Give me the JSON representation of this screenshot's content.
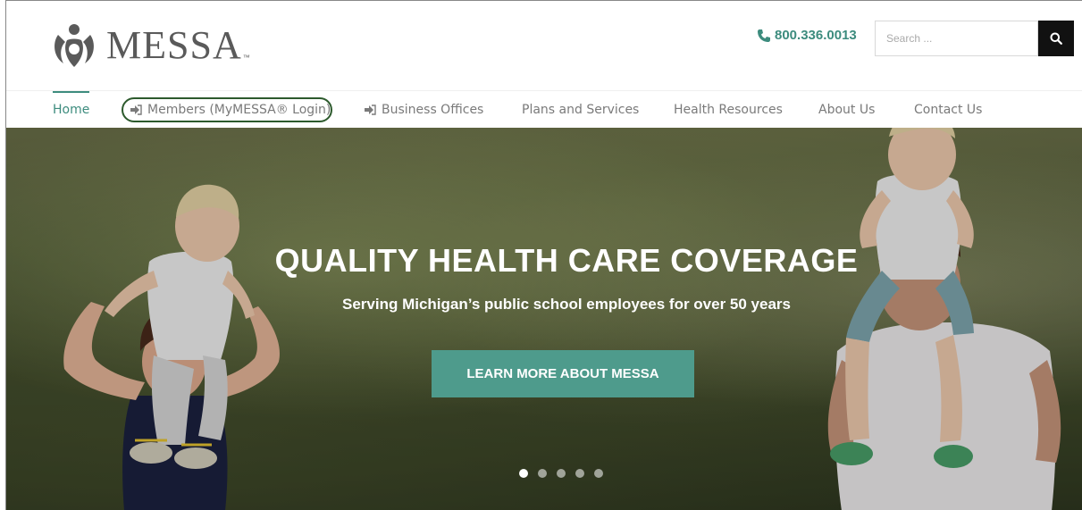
{
  "brand": {
    "name": "MESSA",
    "tm": "™"
  },
  "header": {
    "phone": "800.336.0013",
    "search_placeholder": "Search ..."
  },
  "nav": {
    "items": [
      {
        "label": "Home",
        "active": true
      },
      {
        "label": "Members (MyMESSA® Login)",
        "icon": "sign-in-icon",
        "highlighted": true
      },
      {
        "label": "Business Offices",
        "icon": "sign-in-icon"
      },
      {
        "label": "Plans and Services"
      },
      {
        "label": "Health Resources"
      },
      {
        "label": "About Us"
      },
      {
        "label": "Contact Us"
      }
    ]
  },
  "hero": {
    "title": "QUALITY HEALTH CARE COVERAGE",
    "subtitle": "Serving Michigan’s public school employees for over 50 years",
    "cta_label": "LEARN MORE ABOUT MESSA",
    "slides": 5,
    "active_slide": 1
  },
  "colors": {
    "accent": "#3d8c7e",
    "button": "#4e9b8c",
    "search_button": "#111111",
    "circle_annotation": "#2d5a2d"
  }
}
